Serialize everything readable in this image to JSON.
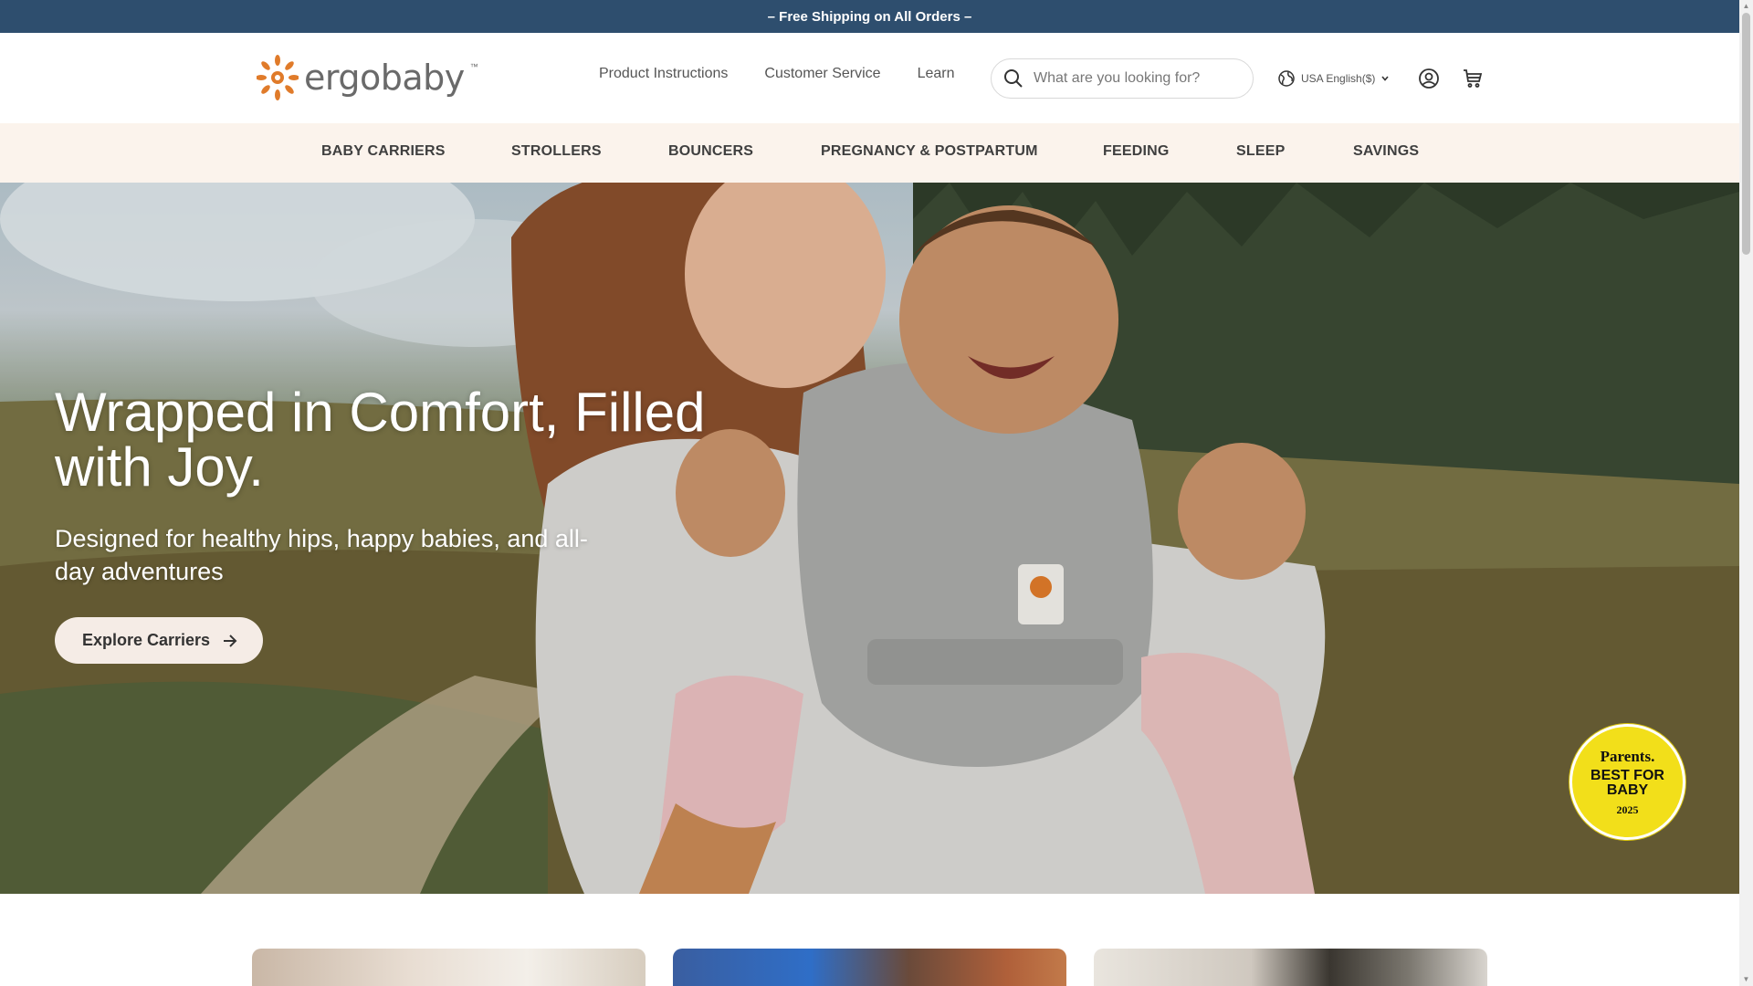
{
  "announcement": "– Free Shipping on All Orders –",
  "brand": {
    "name": "ergobaby",
    "tm": "™"
  },
  "utility_nav": [
    "Product Instructions",
    "Customer Service",
    "Learn"
  ],
  "search": {
    "placeholder": "What are you looking for?",
    "value": ""
  },
  "locale": {
    "label": "USA English($)"
  },
  "icons": {
    "globe": "globe-icon",
    "account": "account-icon",
    "cart": "cart-icon",
    "search": "search-icon",
    "chevron": "chevron-down-icon",
    "arrow": "arrow-right-icon"
  },
  "main_nav": [
    "BABY CARRIERS",
    "STROLLERS",
    "BOUNCERS",
    "PREGNANCY & POSTPARTUM",
    "FEEDING",
    "SLEEP",
    "SAVINGS"
  ],
  "hero": {
    "title": "Wrapped in Comfort, Filled with Joy.",
    "subtitle": "Designed for healthy hips, happy babies, and all-day adventures",
    "cta": "Explore Carriers"
  },
  "award_badge": {
    "brand": "Parents.",
    "line": "BEST FOR BABY",
    "year": "2025"
  },
  "colors": {
    "announcement_bg": "#2e4e6e",
    "nav_bg": "#fbf3ec",
    "brand_orange": "#e07b2a",
    "badge_yellow": "#f2df1a"
  }
}
